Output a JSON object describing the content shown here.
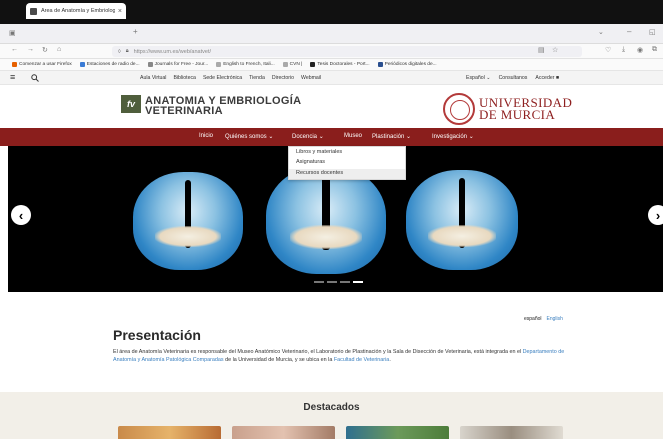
{
  "browser": {
    "tab_title": "Área de Anatomía y Embriología V",
    "tab_close": "×",
    "new_tab": "+",
    "url": "https://www.um.es/web/anatvet/",
    "bookmarks": [
      "Comenzar a usar Firefox",
      "Estaciones de radio de...",
      "Journals for Free - Jour...",
      "English to French, Itali...",
      "CVN |",
      "Tesis Doctorales - Port...",
      "Periódicos digitales de..."
    ]
  },
  "utility_bar": {
    "menu_icon": "≡",
    "search_icon": "search-icon",
    "links": [
      "Aula Virtual",
      "Biblioteca",
      "Sede Electrónica",
      "Tienda",
      "Directorio",
      "Webmail"
    ],
    "language": "Español",
    "consultations": "Consultanos",
    "access": "Acceder"
  },
  "header": {
    "logo_mark": "fv",
    "logo_line1": "ANATOMIA Y EMBRIOLOGÍA",
    "logo_line2": "VETERINARIA",
    "university_line1": "UNIVERSIDAD",
    "university_line2": "DE MURCIA"
  },
  "main_nav": {
    "items": [
      {
        "label": "Inicio"
      },
      {
        "label": "Quiénes somos"
      },
      {
        "label": "Docencia"
      },
      {
        "label": "Museo"
      },
      {
        "label": "Plastinación"
      },
      {
        "label": "Investigación"
      }
    ],
    "chevron": "⌄"
  },
  "docencia_dropdown": {
    "items": [
      "Libros y materiales",
      "Asignaturas",
      "Recursos docentes"
    ],
    "highlighted_index": 2
  },
  "hero": {
    "prev_arrow": "‹",
    "next_arrow": "›",
    "slide_count": 4,
    "active_slide": 3
  },
  "language_switch": {
    "es": "español",
    "en": "English"
  },
  "presentation": {
    "title": "Presentación",
    "text_part1": "El área de Anatomía Veterinaria es responsable del Museo Anatómico Veterinario, el Laboratorio de Plastinación y la Sala de Disección de Veterinaria, está integrada en el ",
    "link1": "Departamento de Anatomía y Anatomía Patológica Comparadas",
    "text_part2": " de la Universidad de Murcia, y se ubica en la ",
    "link2": "Facultad de Veterinaria",
    "text_part3": "."
  },
  "featured": {
    "title": "Destacados"
  },
  "colors": {
    "nav_red": "#8a1e1c",
    "link_blue": "#3a7fbf",
    "logo_green": "#4f5e3c",
    "university_red": "#8e1f1f"
  }
}
